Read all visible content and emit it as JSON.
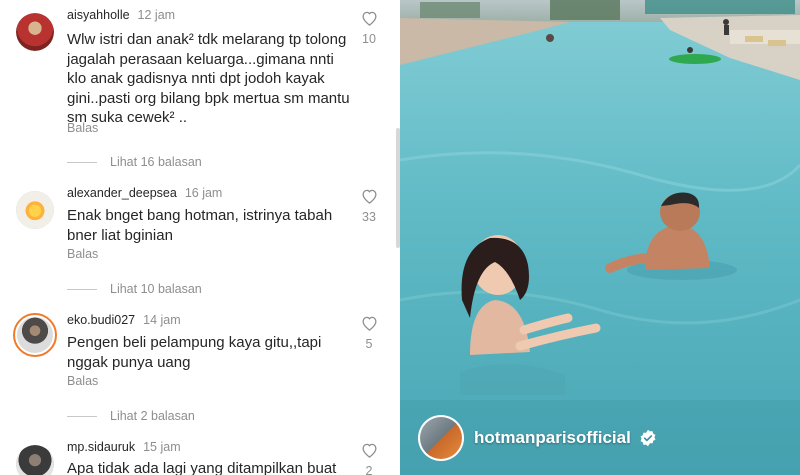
{
  "comments": [
    {
      "username": "aisyahholle",
      "time": "12 jam",
      "lines": [
        "Wlw istri dan anak² tdk melarang tp tolong",
        "jagalah perasaan keluarga...gimana nnti",
        "klo anak gadisnya nnti dpt jodoh kayak",
        "gini..pasti org bilang bpk mertua sm mantu",
        "sm suka cewek² .."
      ],
      "reply_label": "Balas",
      "like_count": "10",
      "view_replies": "Lihat 16 balasan"
    },
    {
      "username": "alexander_deepsea",
      "time": "16 jam",
      "lines": [
        "Enak bnget bang hotman, istrinya tabah",
        "bner liat bginian"
      ],
      "reply_label": "Balas",
      "like_count": "33",
      "view_replies": "Lihat 10 balasan"
    },
    {
      "username": "eko.budi027",
      "time": "14 jam",
      "lines": [
        "Pengen beli pelampung kaya gitu,,tapi",
        "nggak punya uang"
      ],
      "reply_label": "Balas",
      "like_count": "5",
      "view_replies": "Lihat 2 balasan"
    },
    {
      "username": "mp.sidauruk",
      "time": "15 jam",
      "lines": [
        "Apa tidak ada lagi yang ditampilkan buat"
      ],
      "like_count": "2"
    }
  ],
  "post": {
    "owner_username": "hotmanparisofficial",
    "verified": true
  },
  "colors": {
    "text_primary": "#262626",
    "text_secondary": "#8e8e8e",
    "story_ring": "#ef7b2c",
    "verified_badge": "#ffffff",
    "pool_water": "#5db7c3"
  },
  "icons": [
    "heart-icon",
    "verified-badge-icon"
  ]
}
